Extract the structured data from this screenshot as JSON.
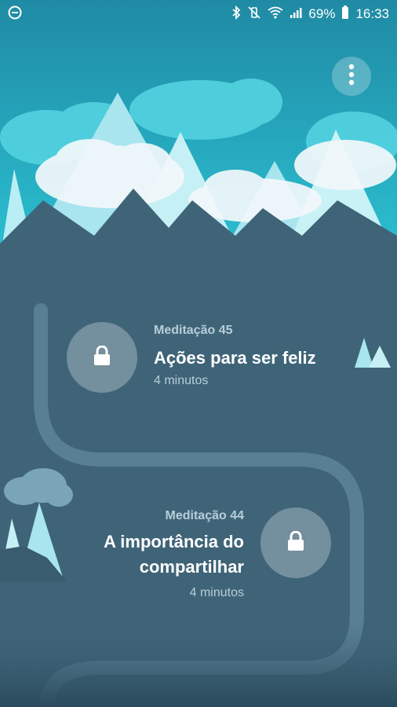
{
  "status_bar": {
    "battery": "69%",
    "time": "16:33",
    "icons": [
      "do-not-disturb-icon",
      "bluetooth-icon",
      "vibrate-icon",
      "wifi-icon",
      "signal-icon",
      "battery-icon"
    ]
  },
  "menu": {
    "icon": "more-vert-icon"
  },
  "meditations": [
    {
      "label": "Meditação 45",
      "title": "Ações para ser feliz",
      "duration": "4 minutos",
      "locked": true
    },
    {
      "label": "Meditação 44",
      "title_line1": "A importância do",
      "title_line2": "compartilhar",
      "duration": "4 minutos",
      "locked": true
    }
  ]
}
